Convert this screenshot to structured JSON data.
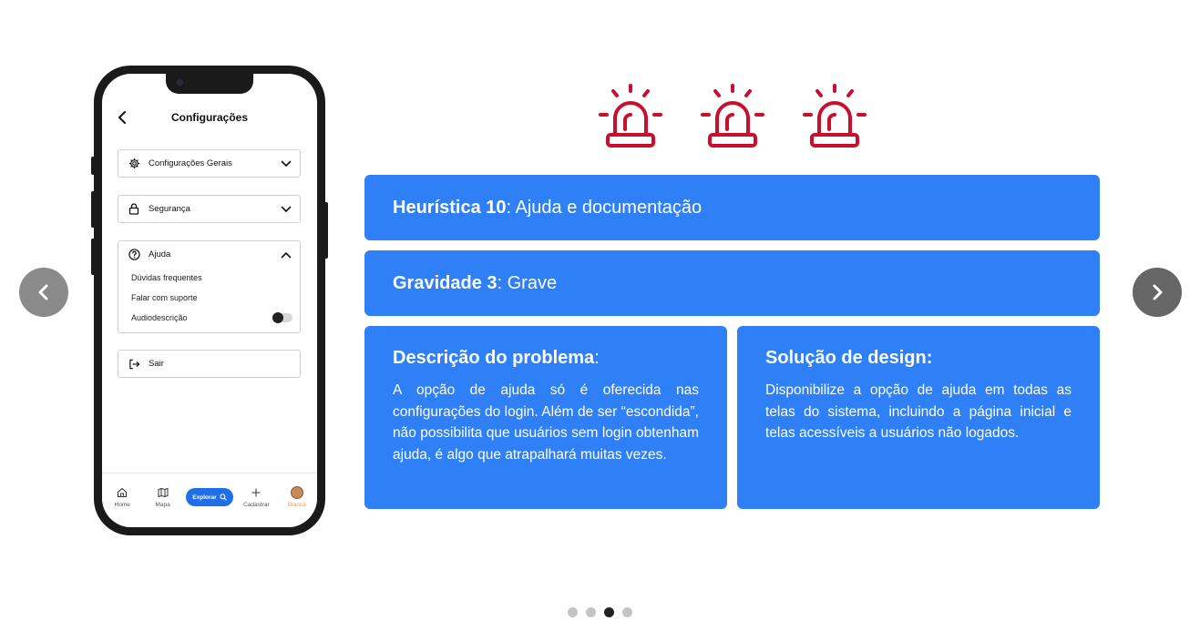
{
  "phone": {
    "title": "Configurações",
    "menu": {
      "general": "Configurações Gerais",
      "security": "Segurança",
      "help": "Ajuda",
      "help_items": [
        "Dúvidas frequentes",
        "Falar com suporte",
        "Audiodescrição"
      ],
      "logout": "Sair"
    },
    "tabs": {
      "home": "Home",
      "map": "Mapa",
      "explore": "Explorar",
      "register": "Cadastrar",
      "profile": "Bianca"
    }
  },
  "heuristic": {
    "label": "Heurística 10",
    "value": ": Ajuda e documentação"
  },
  "severity": {
    "label": "Gravidade 3",
    "value": ": Grave"
  },
  "problem": {
    "title": "Descrição do problema",
    "colon": ":",
    "text": "A opção de ajuda só é oferecida nas configurações do login. Além de ser “escondida”, não possibilita que usuários sem login obtenham ajuda, é algo que atrapalhará muitas vezes."
  },
  "solution": {
    "title": "Solução de design:",
    "text": "Disponibilize a opção de ajuda em todas as telas do sistema, incluindo a página inicial e telas acessíveis a usuários não logados."
  },
  "colors": {
    "card": "#2f80f7",
    "alarm": "#c8102e",
    "accent_tab": "#f2994a",
    "explore": "#1e6fe8"
  },
  "alarm_count": 3,
  "carousel": {
    "total": 4,
    "active": 3
  }
}
